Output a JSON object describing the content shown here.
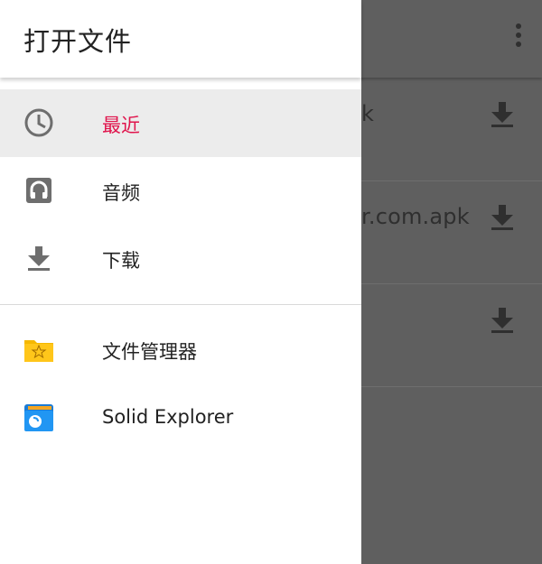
{
  "drawer": {
    "title": "打开文件",
    "items": [
      {
        "label": "最近",
        "icon": "clock-icon",
        "selected": true
      },
      {
        "label": "音频",
        "icon": "headphones-icon"
      },
      {
        "label": "下载",
        "icon": "download-icon"
      }
    ],
    "apps": [
      {
        "label": "文件管理器",
        "icon": "file-manager-app-icon"
      },
      {
        "label": "Solid Explorer",
        "icon": "solid-explorer-app-icon"
      }
    ]
  },
  "background": {
    "rows": [
      {
        "text": "k"
      },
      {
        "text": "r.com.apk"
      },
      {
        "text": ""
      }
    ]
  },
  "colors": {
    "selected_text": "#e0144c",
    "scrim": "#5f5f5f"
  }
}
